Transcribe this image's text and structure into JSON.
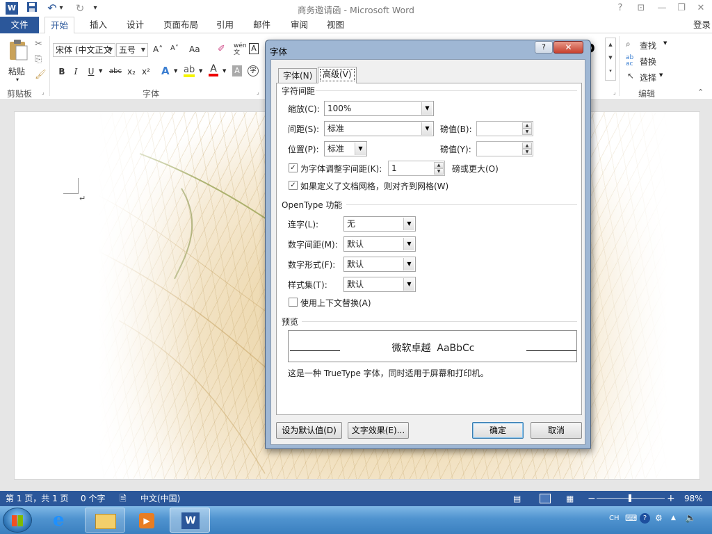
{
  "window": {
    "title": "商务邀请函 - Microsoft Word"
  },
  "titlebar_controls": {
    "help": "?",
    "ribbon_options": "⊡",
    "minimize": "—",
    "restore": "❐",
    "close": "✕"
  },
  "qat": {
    "undo": "↶",
    "redo": "↻",
    "customize": "▾"
  },
  "tabs": [
    "文件",
    "开始",
    "插入",
    "设计",
    "页面布局",
    "引用",
    "邮件",
    "审阅",
    "视图"
  ],
  "login": "登录",
  "ribbon": {
    "paste_label": "粘贴",
    "font_name": "宋体 (中文正文",
    "font_size": "五号",
    "grow_font": "A˄",
    "shrink_font": "A˅",
    "change_case": "Aa",
    "bold": "B",
    "italic": "I",
    "underline": "U",
    "strike": "abc",
    "subscript": "x₂",
    "superscript": "x²",
    "groups": {
      "clipboard": "剪贴板",
      "font": "字体",
      "editing": "编辑"
    },
    "find": "查找",
    "replace": "替换",
    "select": "选择"
  },
  "dialog": {
    "title": "字体",
    "help": "?",
    "close": "✕",
    "tabs": [
      "字体(N)",
      "高级(V)"
    ],
    "spacing_section": "字符间距",
    "scale_label": "缩放(C):",
    "scale_value": "100%",
    "spacing_label": "间距(S):",
    "spacing_value": "标准",
    "spacing_by_label": "磅值(B):",
    "spacing_by_value": "",
    "position_label": "位置(P):",
    "position_value": "标准",
    "position_by_label": "磅值(Y):",
    "position_by_value": "",
    "kerning_label": "为字体调整字间距(K):",
    "kerning_checked": true,
    "kerning_value": "1",
    "kerning_suffix": "磅或更大(O)",
    "snap_grid_label": "如果定义了文档网格，则对齐到网格(W)",
    "snap_grid_checked": true,
    "opentype_section": "OpenType 功能",
    "ligatures_label": "连字(L):",
    "ligatures_value": "无",
    "num_spacing_label": "数字间距(M):",
    "num_spacing_value": "默认",
    "num_forms_label": "数字形式(F):",
    "num_forms_value": "默认",
    "stylistic_label": "样式集(T):",
    "stylistic_value": "默认",
    "contextual_label": "使用上下文替换(A)",
    "contextual_checked": false,
    "preview_section": "预览",
    "preview_text": "微软卓越  AaBbCc",
    "preview_note": "这是一种 TrueType 字体，同时适用于屏幕和打印机。",
    "set_default": "设为默认值(D)",
    "text_effects": "文字效果(E)...",
    "ok": "确定",
    "cancel": "取消"
  },
  "statusbar": {
    "page": "第 1 页，共 1 页",
    "words": "0 个字",
    "language": "中文(中国)",
    "zoom": "98%",
    "zoom_fraction": 0.49
  },
  "tray": {
    "ime": "CH"
  },
  "colors": {
    "brand": "#2b579a",
    "dialog_frame": "#9fb7d4"
  }
}
